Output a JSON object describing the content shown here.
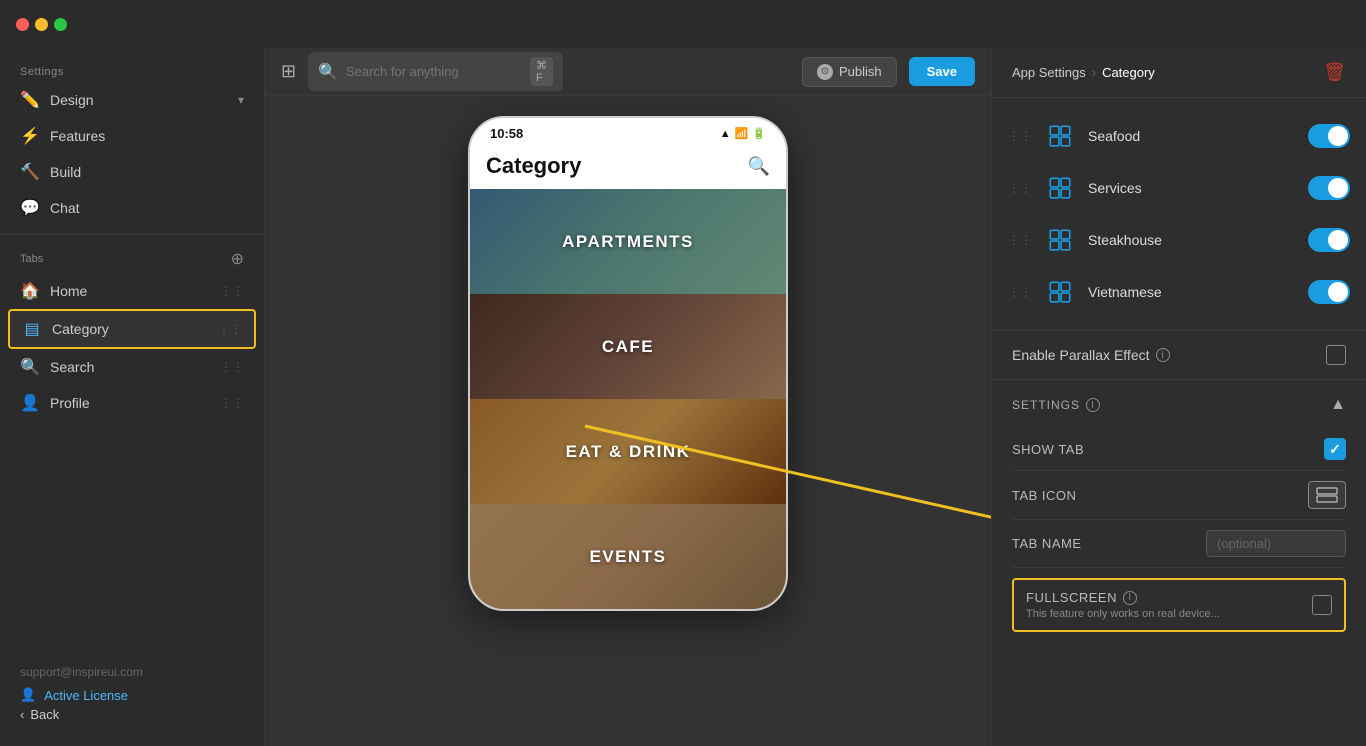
{
  "window": {
    "traffic_lights": [
      "red",
      "yellow",
      "green"
    ]
  },
  "topbar": {
    "search_placeholder": "Search for anything",
    "search_shortcut": "⌘ F",
    "publish_label": "Publish",
    "save_label": "Save"
  },
  "sidebar": {
    "settings_label": "Settings",
    "items": [
      {
        "id": "design",
        "label": "Design",
        "icon": "✏️",
        "has_arrow": true
      },
      {
        "id": "features",
        "label": "Features",
        "icon": "⚡",
        "has_arrow": false
      },
      {
        "id": "build",
        "label": "Build",
        "icon": "🔨",
        "has_arrow": false
      },
      {
        "id": "chat",
        "label": "Chat",
        "icon": "💬",
        "has_arrow": false
      }
    ],
    "tabs_label": "Tabs",
    "tabs": [
      {
        "id": "home",
        "label": "Home",
        "icon": "🏠",
        "active": false
      },
      {
        "id": "category",
        "label": "Category",
        "icon": "▤",
        "active": true
      },
      {
        "id": "search",
        "label": "Search",
        "icon": "🔍",
        "active": false
      },
      {
        "id": "profile",
        "label": "Profile",
        "icon": "👤",
        "active": false
      }
    ],
    "footer": {
      "email": "support@inspireui.com",
      "license_label": "Active License",
      "back_label": "Back"
    }
  },
  "phone": {
    "time": "10:58",
    "title": "Category",
    "cards": [
      {
        "id": "apartments",
        "label": "APARTMENTS"
      },
      {
        "id": "cafe",
        "label": "CAFE"
      },
      {
        "id": "eatdrink",
        "label": "EAT & DRINK"
      },
      {
        "id": "events",
        "label": "EVENTS"
      }
    ]
  },
  "right_panel": {
    "breadcrumb_root": "App Settings",
    "breadcrumb_current": "Category",
    "categories": [
      {
        "id": "seafood",
        "label": "Seafood",
        "enabled": true
      },
      {
        "id": "services",
        "label": "Services",
        "enabled": true
      },
      {
        "id": "steakhouse",
        "label": "Steakhouse",
        "enabled": true
      },
      {
        "id": "vietnamese",
        "label": "Vietnamese",
        "enabled": true
      }
    ],
    "parallax_label": "Enable Parallax Effect",
    "settings_label": "SETTINGS",
    "show_tab_label": "SHOW TAB",
    "tab_icon_label": "TAB ICON",
    "tab_name_label": "TAB NAME",
    "tab_name_placeholder": "(optional)",
    "fullscreen_label": "FULLSCREEN",
    "fullscreen_sublabel": "This feature only works on real device..."
  }
}
